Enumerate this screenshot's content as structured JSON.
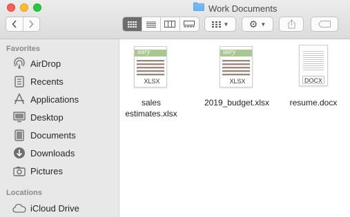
{
  "window": {
    "title": "Work Documents"
  },
  "toolbar": {
    "back_icon": "chevron-left-icon",
    "forward_icon": "chevron-right-icon",
    "view_modes": [
      "icon-view",
      "list-view",
      "column-view",
      "gallery-view"
    ],
    "active_view": "icon-view",
    "group_icon": "group-by-icon",
    "action_icon": "gear-icon",
    "share_icon": "share-icon",
    "tag_icon": "tag-icon"
  },
  "sidebar": {
    "favorites_header": "Favorites",
    "favorites": [
      {
        "label": "AirDrop",
        "icon": "airdrop-icon"
      },
      {
        "label": "Recents",
        "icon": "recents-icon"
      },
      {
        "label": "Applications",
        "icon": "applications-icon"
      },
      {
        "label": "Desktop",
        "icon": "desktop-icon"
      },
      {
        "label": "Documents",
        "icon": "documents-icon"
      },
      {
        "label": "Downloads",
        "icon": "downloads-icon"
      },
      {
        "label": "Pictures",
        "icon": "pictures-icon"
      }
    ],
    "locations_header": "Locations",
    "locations": [
      {
        "label": "iCloud Drive",
        "icon": "icloud-icon"
      }
    ]
  },
  "files": [
    {
      "name_line1": "sales",
      "name_line2": "estimates.xlsx",
      "type_tag": "XLSX",
      "banner": "uary"
    },
    {
      "name_line1": "2019_budget.xlsx",
      "name_line2": "",
      "type_tag": "XLSX",
      "banner": "uary"
    },
    {
      "name_line1": "resume.docx",
      "name_line2": "",
      "type_tag": "DOCX"
    }
  ],
  "colors": {
    "sidebar_bg": "#e8e8e9",
    "close": "#fe5f57",
    "minimize": "#febc2e",
    "zoom": "#28c840",
    "folder_blue": "#6cb6f2",
    "icon_gray": "#6e6e6e"
  }
}
